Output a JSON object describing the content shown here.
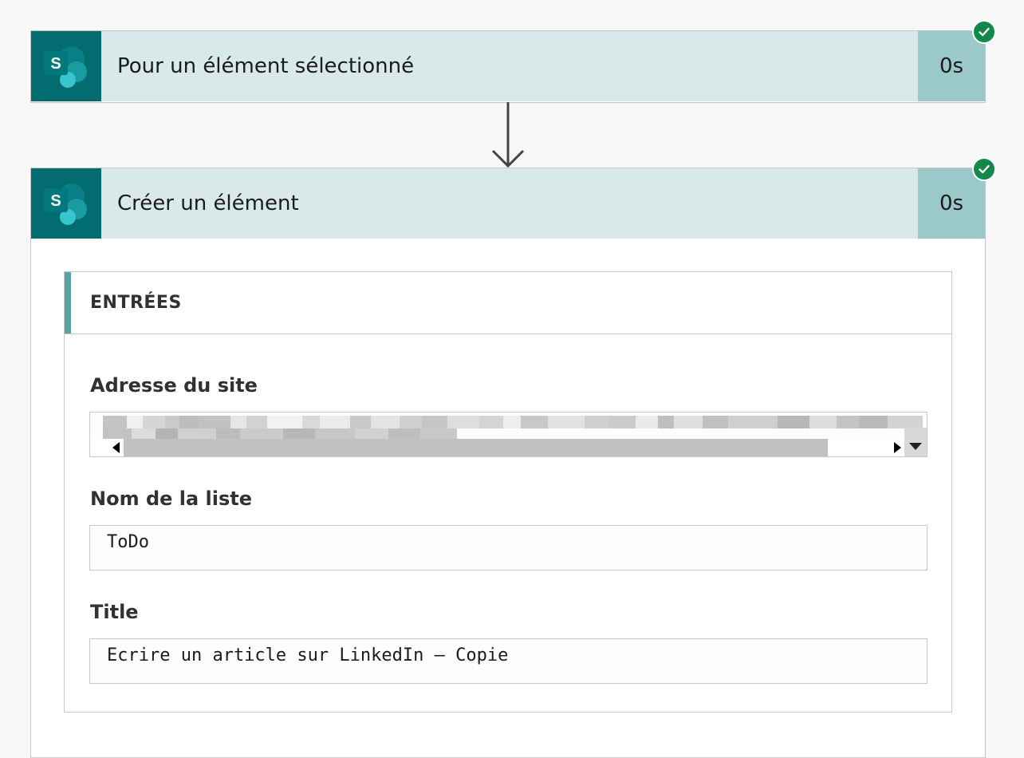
{
  "colors": {
    "page_bg": "#f8f8f8",
    "header_bg": "#d9e8e8",
    "icon_bg": "#036c70",
    "duration_bg": "#9bc8c8",
    "success": "#13884b",
    "accent_bar": "#5aa2a4"
  },
  "steps": [
    {
      "title": "Pour un élément sélectionné",
      "duration": "0s",
      "icon": "sharepoint-icon",
      "status": "success"
    },
    {
      "title": "Créer un élément",
      "duration": "0s",
      "icon": "sharepoint-icon",
      "status": "success"
    }
  ],
  "inputs": {
    "heading": "ENTRÉES",
    "fields": [
      {
        "label": "Adresse du site",
        "value": ""
      },
      {
        "label": "Nom de la liste",
        "value": "ToDo"
      },
      {
        "label": "Title",
        "value": "Ecrire un article sur LinkedIn – Copie"
      }
    ]
  }
}
